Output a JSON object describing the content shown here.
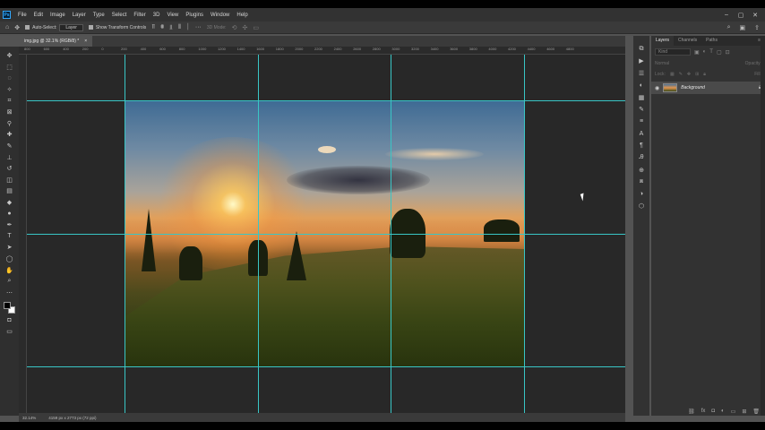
{
  "menubar": {
    "app_icon": "Ps",
    "items": [
      "File",
      "Edit",
      "Image",
      "Layer",
      "Type",
      "Select",
      "Filter",
      "3D",
      "View",
      "Plugins",
      "Window",
      "Help"
    ],
    "window_controls": [
      "–",
      "▢",
      "✕"
    ]
  },
  "options": {
    "auto_select_label": "Auto-Select:",
    "auto_select_value": "Layer",
    "transform_label": "Show Transform Controls",
    "mode_label": "3D Mode:"
  },
  "document": {
    "tab_title": "img.jpg @ 32.1% (RGB/8) *",
    "tab_close": "×"
  },
  "ruler": {
    "h_ticks": [
      "800",
      "600",
      "400",
      "200",
      "0",
      "200",
      "400",
      "600",
      "800",
      "1000",
      "1200",
      "1400",
      "1600",
      "1800",
      "2000",
      "2200",
      "2400",
      "2600",
      "2800",
      "3000",
      "3200",
      "3400",
      "3600",
      "3800",
      "4000",
      "4200",
      "4400",
      "4600",
      "4800"
    ]
  },
  "status": {
    "zoom": "32.14%",
    "doc_size": "4159 px x 2773 px (72 ppi)"
  },
  "panel": {
    "tabs": [
      "Layers",
      "Channels",
      "Paths"
    ],
    "kind_placeholder": "Kind",
    "blend_mode": "Normal",
    "opacity_label": "Opacity:",
    "lock_label": "Lock:",
    "fill_label": "Fill:",
    "layer_name": "Background"
  },
  "colors": {
    "guide": "#39c6c6",
    "accent": "#31a8ff"
  }
}
